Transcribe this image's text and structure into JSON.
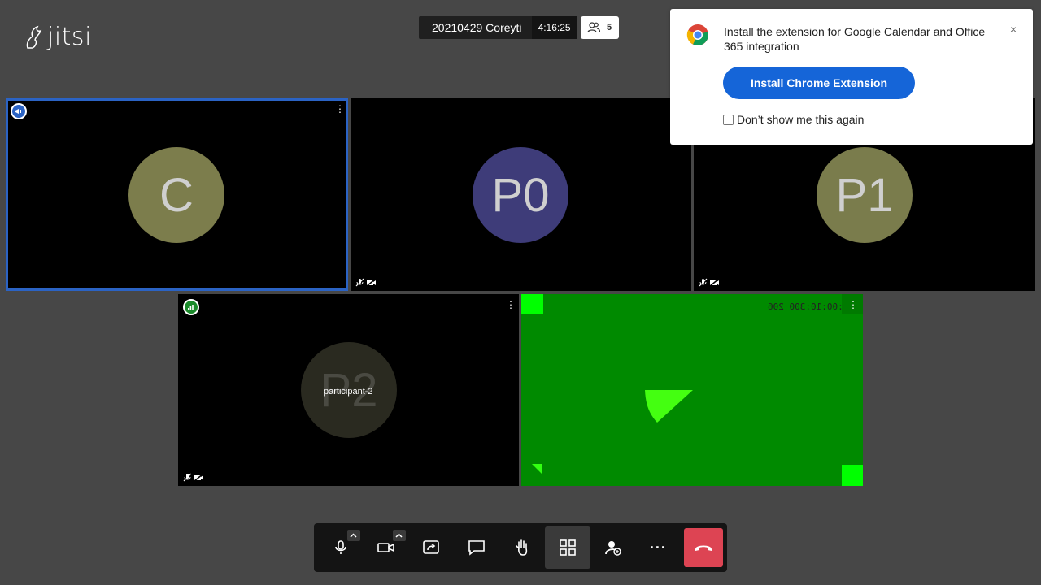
{
  "app": {
    "logo_text": "jitsi"
  },
  "header": {
    "meeting_name": "20210429 Coreyti",
    "timer": "4:16:25",
    "participant_count": "5"
  },
  "popup": {
    "message": "Install the extension for Google Calendar and Office 365 integration",
    "install_label": "Install Chrome Extension",
    "dont_show_label": "Don’t show me this again",
    "close_glyph": "×",
    "dont_show_checked": false
  },
  "tiles": [
    {
      "initials": "C",
      "avatar_color": "#7c7d4c",
      "active": true
    },
    {
      "initials": "P0",
      "avatar_color": "#3e3c79"
    },
    {
      "initials": "P1",
      "avatar_color": "#7a7c4c"
    },
    {
      "initials": "P2",
      "avatar_color": "#2a2a20",
      "display_name": "participant-2"
    },
    {
      "overlay_text": "0:00:10:300 206",
      "background": "#008a00"
    }
  ],
  "tile_menu_glyph": "⋮",
  "toolbar": {
    "buttons": [
      "microphone",
      "camera",
      "share-screen",
      "chat",
      "raise-hand",
      "tile-view",
      "invite",
      "more-actions",
      "leave-call"
    ],
    "more_glyph": "···"
  },
  "colors": {
    "background": "#474747",
    "active_border": "#2b63c4",
    "install_button": "#1565d8",
    "hangup": "#dd4453",
    "video_green": "#008a00"
  }
}
